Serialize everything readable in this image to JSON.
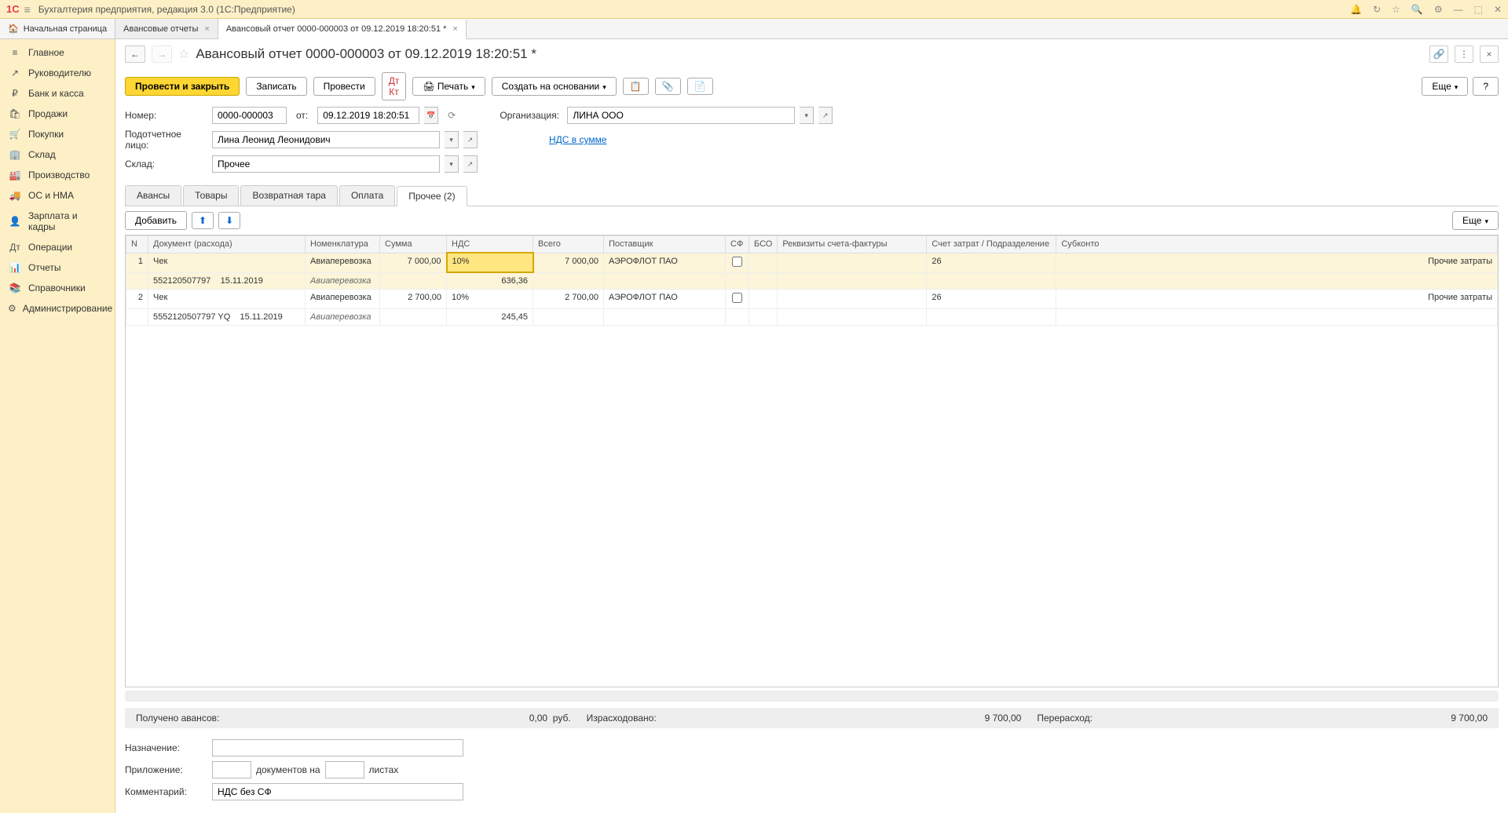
{
  "titlebar": {
    "app_title": "Бухгалтерия предприятия, редакция 3.0  (1С:Предприятие)",
    "logo": "1C"
  },
  "tabs_top": {
    "home": "Начальная страница",
    "t1": "Авансовые отчеты",
    "t2": "Авансовый отчет 0000-000003 от 09.12.2019 18:20:51 *"
  },
  "sidebar": [
    {
      "icon": "≡",
      "label": "Главное"
    },
    {
      "icon": "↗",
      "label": "Руководителю"
    },
    {
      "icon": "₽",
      "label": "Банк и касса"
    },
    {
      "icon": "🛍",
      "label": "Продажи"
    },
    {
      "icon": "🛒",
      "label": "Покупки"
    },
    {
      "icon": "🏢",
      "label": "Склад"
    },
    {
      "icon": "🏭",
      "label": "Производство"
    },
    {
      "icon": "🚚",
      "label": "ОС и НМА"
    },
    {
      "icon": "👤",
      "label": "Зарплата и кадры"
    },
    {
      "icon": "Дт",
      "label": "Операции"
    },
    {
      "icon": "📊",
      "label": "Отчеты"
    },
    {
      "icon": "📚",
      "label": "Справочники"
    },
    {
      "icon": "⚙",
      "label": "Администрирование"
    }
  ],
  "doc": {
    "title": "Авансовый отчет 0000-000003 от 09.12.2019 18:20:51 *",
    "buttons": {
      "post_close": "Провести и закрыть",
      "write": "Записать",
      "post": "Провести",
      "print": "Печать",
      "create_based": "Создать на основании",
      "more": "Еще",
      "help": "?"
    },
    "fields": {
      "number_label": "Номер:",
      "number": "0000-000003",
      "from_label": "от:",
      "date": "09.12.2019 18:20:51",
      "org_label": "Организация:",
      "org": "ЛИНА ООО",
      "person_label": "Подотчетное лицо:",
      "person": "Лина Леонид Леонидович",
      "vat_link": "НДС в сумме",
      "warehouse_label": "Склад:",
      "warehouse": "Прочее"
    },
    "tabs": {
      "t1": "Авансы",
      "t2": "Товары",
      "t3": "Возвратная тара",
      "t4": "Оплата",
      "t5": "Прочее (2)"
    },
    "sub": {
      "add": "Добавить",
      "more": "Еще"
    },
    "columns": {
      "n": "N",
      "doc": "Документ (расхода)",
      "nomen": "Номенклатура",
      "sum": "Сумма",
      "vat": "НДС",
      "total": "Всего",
      "supplier": "Поставщик",
      "sf": "СФ",
      "bso": "БСО",
      "req": "Реквизиты счета-фактуры",
      "account": "Счет затрат / Подразделение",
      "subk": "Субконто"
    },
    "rows": [
      {
        "n": "1",
        "doc": "Чек",
        "doc2": "552120507797",
        "date2": "15.11.2019",
        "nomen": "Авиаперевозка",
        "nomen2": "Авиаперевозка",
        "sum": "7 000,00",
        "vat": "10%",
        "vat2": "636,36",
        "total": "7 000,00",
        "supplier": "АЭРОФЛОТ ПАО",
        "account": "26",
        "subk": "Прочие затраты",
        "selected": true
      },
      {
        "n": "2",
        "doc": "Чек",
        "doc2": "5552120507797 YQ",
        "date2": "15.11.2019",
        "nomen": "Авиаперевозка",
        "nomen2": "Авиаперевозка",
        "sum": "2 700,00",
        "vat": "10%",
        "vat2": "245,45",
        "total": "2 700,00",
        "supplier": "АЭРОФЛОТ ПАО",
        "account": "26",
        "subk": "Прочие затраты",
        "selected": false
      }
    ],
    "totals": {
      "received_label": "Получено авансов:",
      "received": "0,00",
      "currency": "руб.",
      "spent_label": "Израсходовано:",
      "spent": "9 700,00",
      "over_label": "Перерасход:",
      "over": "9 700,00"
    },
    "bottom": {
      "purpose_label": "Назначение:",
      "purpose": "",
      "attach_label": "Приложение:",
      "docs_on": "документов на",
      "sheets": "листах",
      "comment_label": "Комментарий:",
      "comment": "НДС без СФ"
    }
  }
}
